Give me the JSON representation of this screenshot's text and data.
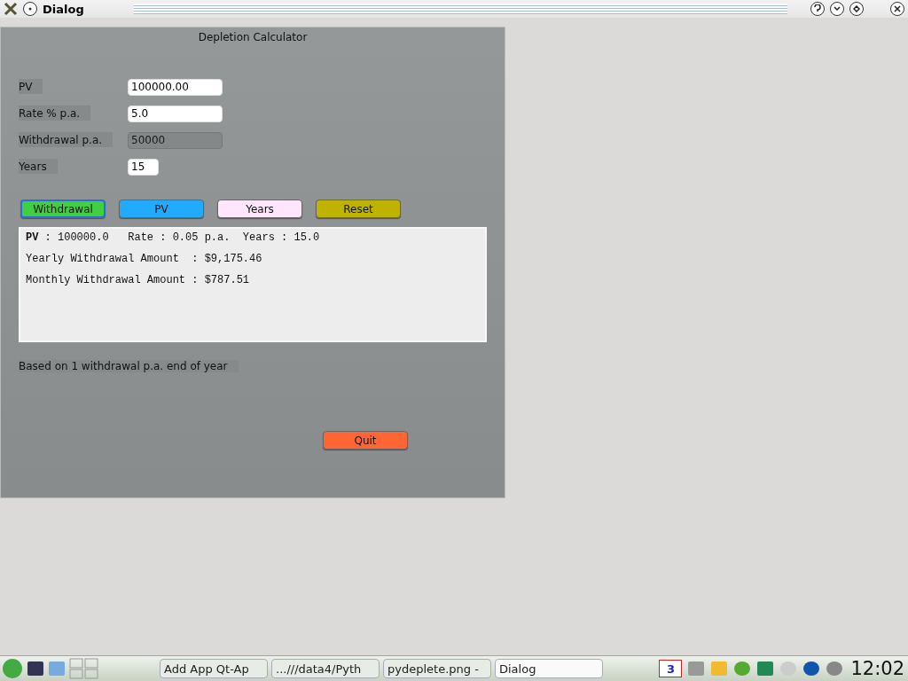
{
  "window": {
    "title": "Dialog"
  },
  "dialog": {
    "heading": "Depletion  Calculator",
    "fields": [
      {
        "label": "PV",
        "value": "100000.00",
        "disabled": false,
        "kind": "wide"
      },
      {
        "label": "Rate % p.a.",
        "value": "5.0",
        "disabled": false,
        "kind": "wide"
      },
      {
        "label": "Withdrawal p.a.",
        "value": "50000",
        "disabled": true,
        "kind": "wide"
      },
      {
        "label": "Years",
        "value": "15",
        "disabled": false,
        "kind": "narrow"
      }
    ],
    "buttons": [
      {
        "label": "Withdrawal",
        "color": "#3fcf3f",
        "focused": true
      },
      {
        "label": "PV",
        "color": "#22aaff",
        "focused": false
      },
      {
        "label": "Years",
        "color": "#ffe6fa",
        "focused": false
      },
      {
        "label": "Reset",
        "color": "#bdb300",
        "focused": false
      }
    ],
    "output_lines": [
      "**PV** : 100000.0   Rate : 0.05 p.a.  Years : 15.0",
      "Yearly Withdrawal Amount  : $9,175.46",
      "Monthly Withdrawal Amount : $787.51"
    ],
    "note": "Based on 1 withdrawal p.a. end of year",
    "quit_button": {
      "label": "Quit",
      "color": "#ff6633"
    }
  },
  "taskbar": {
    "tasks": [
      {
        "label": "Add App Qt-Ap",
        "selected": false
      },
      {
        "label": "...///data4/Pyth",
        "selected": false
      },
      {
        "label": "pydeplete.png -",
        "selected": false
      },
      {
        "label": "Dialog",
        "selected": true
      }
    ],
    "mail_count": "3",
    "clock": "12:02"
  }
}
